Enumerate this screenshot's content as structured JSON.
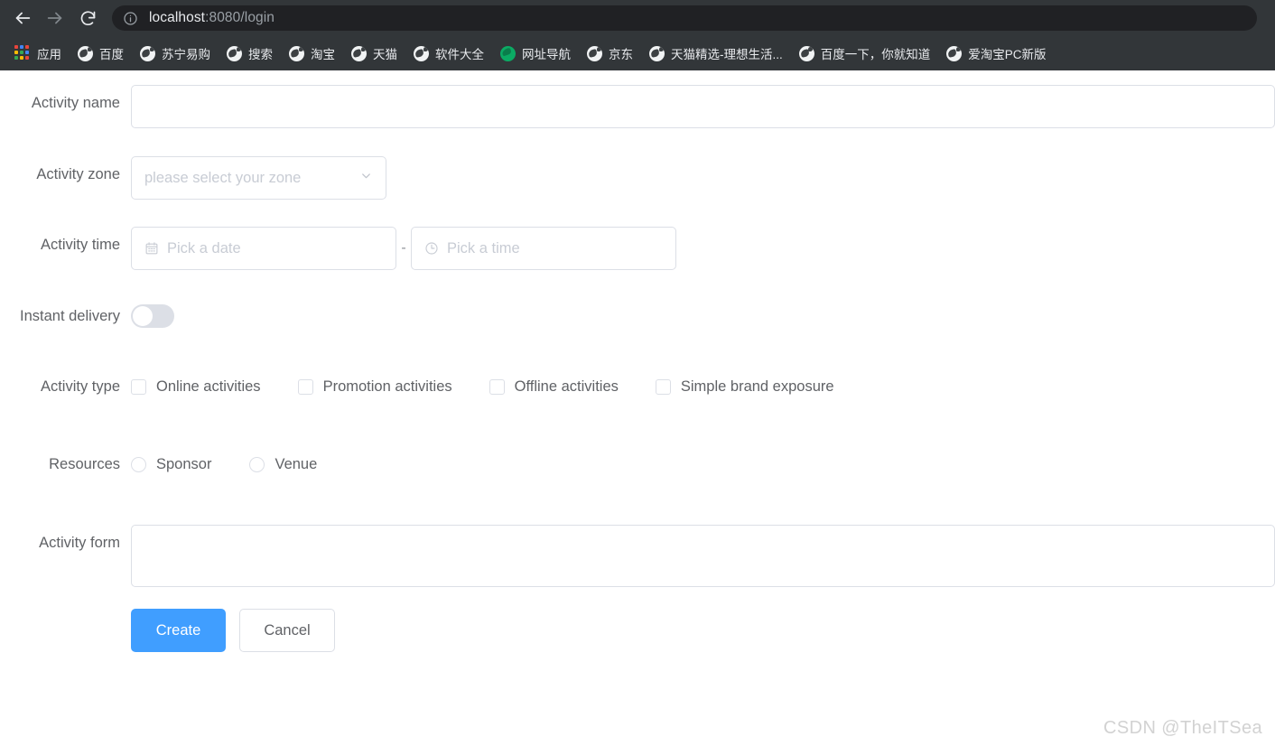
{
  "browser": {
    "back_icon": "arrow-left-icon",
    "forward_icon": "arrow-right-icon",
    "reload_icon": "reload-icon",
    "site_info_icon": "info-circle-icon",
    "url_host": "localhost",
    "url_path": ":8080/login",
    "chrome_bg": "#323639",
    "omnibox_bg": "#202124"
  },
  "bookmarks": {
    "apps_label": "应用",
    "apps_icon": "apps-grid-icon",
    "apps_colors": [
      "#e8453c",
      "#4285f4",
      "#fbbc05",
      "#34a853",
      "#e8453c",
      "#4285f4",
      "#fbbc05",
      "#34a853",
      "#e8453c"
    ],
    "items": [
      {
        "label": "百度",
        "icon": "globe-favicon"
      },
      {
        "label": "苏宁易购",
        "icon": "globe-favicon"
      },
      {
        "label": "搜索",
        "icon": "globe-favicon"
      },
      {
        "label": "淘宝",
        "icon": "globe-favicon"
      },
      {
        "label": "天猫",
        "icon": "globe-favicon"
      },
      {
        "label": "软件大全",
        "icon": "globe-favicon"
      },
      {
        "label": "网址导航",
        "icon": "green-favicon"
      },
      {
        "label": "京东",
        "icon": "globe-favicon"
      },
      {
        "label": "天猫精选-理想生活...",
        "icon": "globe-favicon"
      },
      {
        "label": "百度一下，你就知道",
        "icon": "globe-favicon"
      },
      {
        "label": "爱淘宝PC新版",
        "icon": "globe-favicon"
      }
    ]
  },
  "form": {
    "activity_name": {
      "label": "Activity name",
      "value": "",
      "placeholder": ""
    },
    "activity_zone": {
      "label": "Activity zone",
      "value": "",
      "placeholder": "please select your zone",
      "chevron_icon": "chevron-down-icon"
    },
    "activity_time": {
      "label": "Activity time",
      "date_placeholder": "Pick a date",
      "date_value": "",
      "date_icon": "calendar-icon",
      "separator": "-",
      "time_placeholder": "Pick a time",
      "time_value": "",
      "time_icon": "clock-icon"
    },
    "instant_delivery": {
      "label": "Instant delivery",
      "checked": false
    },
    "activity_type": {
      "label": "Activity type",
      "options": [
        {
          "label": "Online activities",
          "checked": false
        },
        {
          "label": "Promotion activities",
          "checked": false
        },
        {
          "label": "Offline activities",
          "checked": false
        },
        {
          "label": "Simple brand exposure",
          "checked": false
        }
      ]
    },
    "resources": {
      "label": "Resources",
      "options": [
        {
          "label": "Sponsor",
          "checked": false
        },
        {
          "label": "Venue",
          "checked": false
        }
      ]
    },
    "activity_form": {
      "label": "Activity form",
      "value": "",
      "placeholder": ""
    },
    "actions": {
      "create_label": "Create",
      "cancel_label": "Cancel",
      "primary_color": "#409eff"
    }
  },
  "watermark": {
    "text": "CSDN @TheITSea"
  }
}
